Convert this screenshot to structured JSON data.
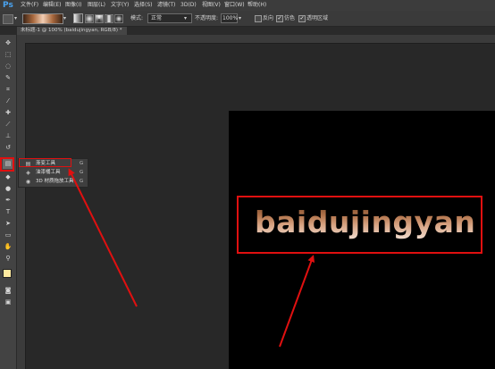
{
  "app": {
    "logo": "Ps"
  },
  "menubar": {
    "items": [
      "文件(F)",
      "编辑(E)",
      "图像(I)",
      "图层(L)",
      "文字(Y)",
      "选择(S)",
      "滤镜(T)",
      "3D(D)",
      "视图(V)",
      "窗口(W)",
      "帮助(H)"
    ]
  },
  "options": {
    "mode_label": "模式:",
    "mode_value": "正常",
    "opacity_label": "不透明度:",
    "opacity_value": "100%",
    "reverse_label": "反向",
    "dither_label": "仿色",
    "transparency_label": "透明区域",
    "reverse_checked": false,
    "dither_checked": true,
    "transparency_checked": true
  },
  "document": {
    "tab_title": "未标题-1 @ 100% (baidujingyan, RGB/8) *"
  },
  "canvas": {
    "text": "baidujingyan",
    "gradient_colors": [
      "#7a4a2c",
      "#b0724a",
      "#d6a07e",
      "#f4e2d6"
    ]
  },
  "flyout": {
    "items": [
      {
        "label": "渐变工具",
        "shortcut": "G",
        "icon": "gradient-icon"
      },
      {
        "label": "油漆桶工具",
        "shortcut": "G",
        "icon": "paint-bucket-icon"
      },
      {
        "label": "3D 材质拖放工具",
        "shortcut": "G",
        "icon": "3d-material-drop-icon"
      }
    ]
  },
  "colors": {
    "highlight": "#e01010",
    "foreground_swatch": "#ffeaa0",
    "background_swatch": "#ffffff"
  }
}
